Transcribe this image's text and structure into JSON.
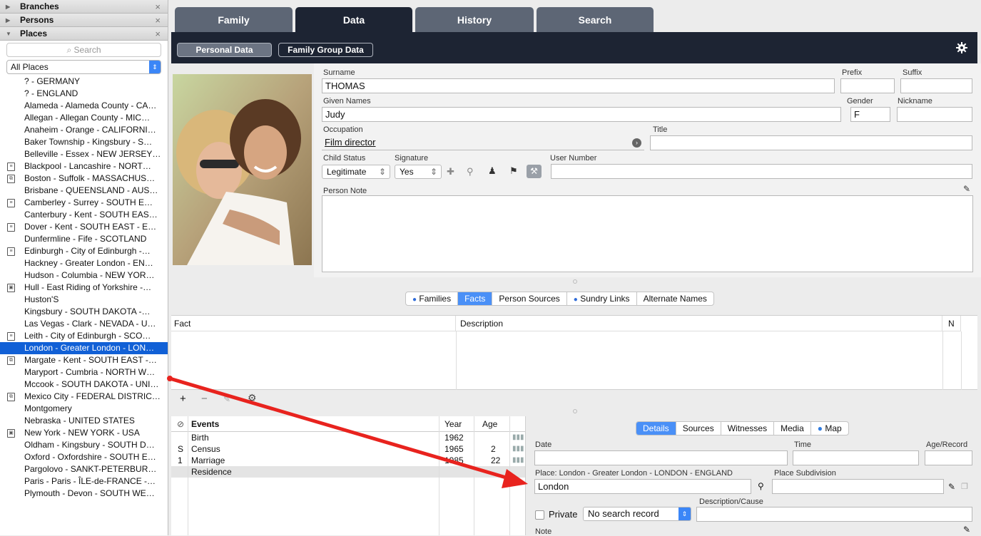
{
  "sidebar": {
    "sections": [
      {
        "label": "Branches"
      },
      {
        "label": "Persons"
      },
      {
        "label": "Places"
      }
    ],
    "search_placeholder": "Search",
    "filter": "All Places",
    "places": [
      {
        "label": "? - GERMANY",
        "icon": ""
      },
      {
        "label": "? - ENGLAND",
        "icon": ""
      },
      {
        "label": "Alameda - Alameda County - CA…",
        "icon": ""
      },
      {
        "label": "Allegan - Allegan County - MIC…",
        "icon": ""
      },
      {
        "label": "Anaheim - Orange - CALIFORNI…",
        "icon": ""
      },
      {
        "label": "Baker Township - Kingsbury - S…",
        "icon": ""
      },
      {
        "label": "Belleville - Essex - NEW JERSEY…",
        "icon": ""
      },
      {
        "label": "Blackpool - Lancashire - NORT…",
        "icon": "note-icon"
      },
      {
        "label": "Boston - Suffolk - MASSACHUS…",
        "icon": "copy-note-icon"
      },
      {
        "label": "Brisbane - QUEENSLAND - AUS…",
        "icon": ""
      },
      {
        "label": "Camberley - Surrey - SOUTH E…",
        "icon": "note-icon"
      },
      {
        "label": "Canterbury - Kent - SOUTH EAS…",
        "icon": ""
      },
      {
        "label": "Dover - Kent - SOUTH EAST - E…",
        "icon": "note-icon"
      },
      {
        "label": "Dunfermline - Fife - SCOTLAND",
        "icon": ""
      },
      {
        "label": "Edinburgh - City of Edinburgh -…",
        "icon": "note-icon"
      },
      {
        "label": "Hackney - Greater London - EN…",
        "icon": ""
      },
      {
        "label": "Hudson - Columbia - NEW YOR…",
        "icon": ""
      },
      {
        "label": "Hull - East Riding of Yorkshire -…",
        "icon": "image-icon"
      },
      {
        "label": "Huston'S",
        "icon": ""
      },
      {
        "label": "Kingsbury - SOUTH DAKOTA -…",
        "icon": ""
      },
      {
        "label": "Las Vegas - Clark - NEVADA - U…",
        "icon": ""
      },
      {
        "label": "Leith - City of Edinburgh - SCO…",
        "icon": "note-icon"
      },
      {
        "label": "London - Greater London - LON…",
        "icon": "",
        "selected": true
      },
      {
        "label": "Margate - Kent - SOUTH EAST -…",
        "icon": "copy-note-icon"
      },
      {
        "label": "Maryport - Cumbria - NORTH W…",
        "icon": ""
      },
      {
        "label": "Mccook - SOUTH DAKOTA - UNI…",
        "icon": ""
      },
      {
        "label": "Mexico City - FEDERAL DISTRIC…",
        "icon": "copy-note-icon"
      },
      {
        "label": "Montgomery",
        "icon": ""
      },
      {
        "label": "Nebraska - UNITED STATES",
        "icon": ""
      },
      {
        "label": "New York - NEW YORK - USA",
        "icon": "image-icon"
      },
      {
        "label": "Oldham - Kingsbury - SOUTH D…",
        "icon": ""
      },
      {
        "label": "Oxford - Oxfordshire - SOUTH E…",
        "icon": ""
      },
      {
        "label": "Pargolovo - SANKT-PETERBUR…",
        "icon": ""
      },
      {
        "label": "Paris - Paris - ÎLE-de-FRANCE -…",
        "icon": ""
      },
      {
        "label": "Plymouth - Devon - SOUTH WE…",
        "icon": ""
      }
    ]
  },
  "tabs": [
    "Family",
    "Data",
    "History",
    "Search"
  ],
  "subtabs": [
    "Personal Data",
    "Family Group Data"
  ],
  "person": {
    "surname_label": "Surname",
    "surname": "THOMAS",
    "prefix_label": "Prefix",
    "suffix_label": "Suffix",
    "given_label": "Given Names",
    "given": "Judy",
    "gender_label": "Gender",
    "gender": "F",
    "nickname_label": "Nickname",
    "occupation_label": "Occupation",
    "occupation": "Film director",
    "title_label": "Title",
    "child_status_label": "Child Status",
    "child_status": "Legitimate",
    "signature_label": "Signature",
    "signature": "Yes",
    "user_number_label": "User Number",
    "note_label": "Person Note"
  },
  "fact_tabs": [
    "Families",
    "Facts",
    "Person Sources",
    "Sundry Links",
    "Alternate Names"
  ],
  "facts_table": {
    "col_fact": "Fact",
    "col_desc": "Description",
    "col_n": "N"
  },
  "events": {
    "col_events": "Events",
    "col_year": "Year",
    "col_age": "Age",
    "rows": [
      {
        "flag": "",
        "name": "Birth",
        "year": "1962",
        "age": ""
      },
      {
        "flag": "S",
        "name": "Census",
        "year": "1965",
        "age": "2"
      },
      {
        "flag": "1",
        "name": "Marriage",
        "year": "1985",
        "age": "22"
      },
      {
        "flag": "",
        "name": "Residence",
        "year": "",
        "age": ""
      }
    ]
  },
  "detail_tabs": [
    "Details",
    "Sources",
    "Witnesses",
    "Media",
    "Map"
  ],
  "details": {
    "date_label": "Date",
    "time_label": "Time",
    "age_record_label": "Age/Record",
    "place_label": "Place: London - Greater London - LONDON - ENGLAND",
    "place_value": "London",
    "place_subdivision_label": "Place Subdivision",
    "description_label": "Description/Cause",
    "private_label": "Private",
    "search_record": "No search record",
    "note_label": "Note"
  },
  "colors": {
    "accent": "#1160d6",
    "dark_bar": "#1d2433",
    "arrow": "#e8231e"
  }
}
